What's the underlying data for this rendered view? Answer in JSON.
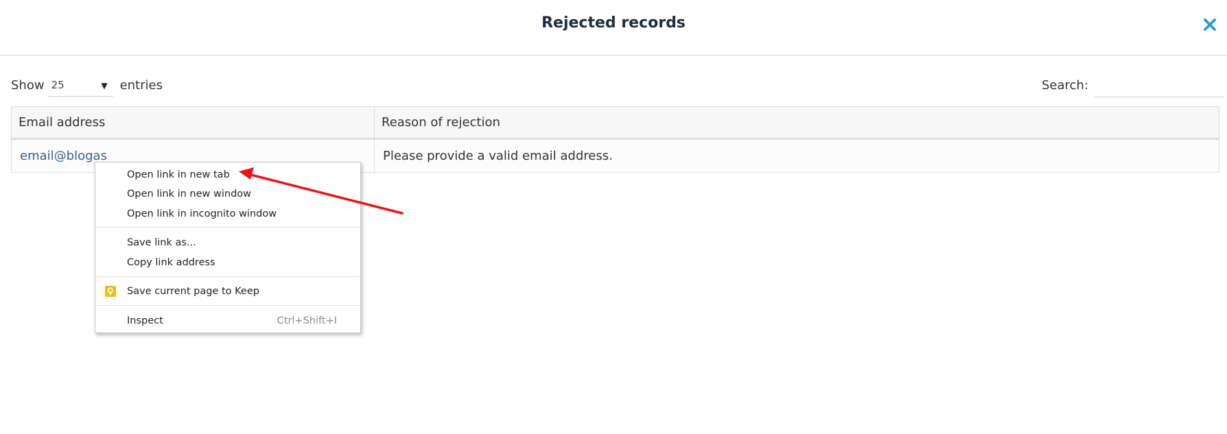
{
  "modal": {
    "title": "Rejected records",
    "close_icon": "close-icon",
    "accent_color": "#2a9fd6"
  },
  "controls": {
    "show_label": "Show",
    "entries_label": "entries",
    "page_length": "25",
    "search_label": "Search:",
    "search_value": ""
  },
  "table": {
    "columns": [
      "Email address",
      "Reason of rejection"
    ],
    "rows": [
      {
        "email": "email@blogas",
        "reason": "Please provide a valid email address."
      }
    ]
  },
  "context_menu": {
    "open_new_tab": "Open link in new tab",
    "open_new_window": "Open link in new window",
    "open_incognito": "Open link in incognito window",
    "save_link_as": "Save link as...",
    "copy_link_address": "Copy link address",
    "save_to_keep": "Save current page to Keep",
    "keep_icon": "keep-icon",
    "keep_color": "#f6bb11",
    "inspect": "Inspect",
    "inspect_shortcut": "Ctrl+Shift+I"
  },
  "annotation": {
    "arrow_color": "#e8141a"
  }
}
